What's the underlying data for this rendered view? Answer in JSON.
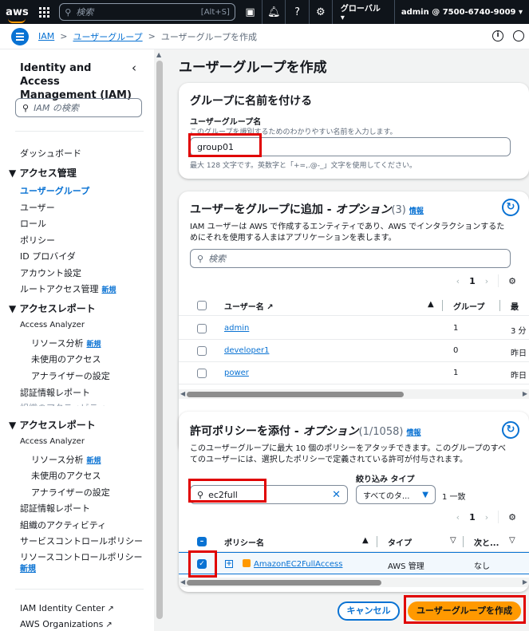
{
  "topnav": {
    "logo": "aws",
    "search_placeholder": "検索",
    "search_shortcut": "[Alt+S]",
    "region": "グローバル ▾",
    "account": "admin @ 7500-6740-9009 ▾"
  },
  "breadcrumb": {
    "items": [
      "IAM",
      "ユーザーグループ"
    ],
    "current": "ユーザーグループを作成"
  },
  "sidebar": {
    "title": "Identity and Access Management (IAM)",
    "search_placeholder": "IAM の検索",
    "dashboard": "ダッシュボード",
    "access_mgmt": "▼ アクセス管理",
    "user_groups": "ユーザーグループ",
    "users": "ユーザー",
    "roles": "ロール",
    "policies": "ポリシー",
    "id_providers": "ID プロバイダ",
    "account_settings": "アカウント設定",
    "root_access": "ルートアクセス管理",
    "new_badge": "新規",
    "access_reports": "▼ アクセスレポート",
    "access_analyzer": "Access Analyzer",
    "resource_analysis": "リソース分析",
    "unused_access": "未使用のアクセス",
    "analyzer_settings": "アナライザーの設定",
    "credential_report": "認証情報レポート",
    "org_activity": "組織のアクティビティ",
    "scp": "サービスコントロールポリシー",
    "rcp": "リソースコントロールポリシー",
    "identity_center": "IAM Identity Center",
    "organizations": "AWS Organizations"
  },
  "main": {
    "page_title": "ユーザーグループを作成",
    "name_section": {
      "heading": "グループに名前を付ける",
      "label": "ユーザーグループ名",
      "description": "このグループを識別するためのわかりやすい名前を入力します。",
      "value": "group01",
      "constraint": "最大 128 文字です。英数字と「+=,.@-_」文字を使用してください。"
    },
    "users_section": {
      "heading_a": "ユーザーをグループに追加 - ",
      "heading_b": "オプション",
      "count": "(3)",
      "info": "情報",
      "description": "IAM ユーザーは AWS で作成するエンティティであり、AWS でインタラクションするためにそれを使用する人まはアプリケーションを表します。",
      "search_placeholder": "検索",
      "page": "1",
      "columns": [
        "ユーザー名",
        "グループ",
        "最"
      ],
      "rows": [
        {
          "name": "admin",
          "groups": "1",
          "last": "3 分"
        },
        {
          "name": "developer1",
          "groups": "0",
          "last": "昨日"
        },
        {
          "name": "power",
          "groups": "1",
          "last": "昨日"
        }
      ]
    },
    "policy_section": {
      "heading_a": "許可ポリシーを添付 - ",
      "heading_b": "オプション",
      "count": "(1/1058)",
      "info": "情報",
      "description": "このユーザーグループに最大 10 個のポリシーをアタッチできます。このグループのすべてのユーザーには、選択したポリシーで定義されている許可が付与されます。",
      "filter_label": "絞り込み タイプ",
      "search_value": "ec2full",
      "filter_value": "すべてのタ...",
      "match_count": "1 一致",
      "page": "1",
      "columns": [
        "ポリシー名",
        "タイプ",
        "次と..."
      ],
      "rows": [
        {
          "name": "AmazonEC2FullAccess",
          "type": "AWS 管理",
          "next": "なし"
        }
      ]
    },
    "cancel": "キャンセル",
    "create": "ユーザーグループを作成"
  }
}
